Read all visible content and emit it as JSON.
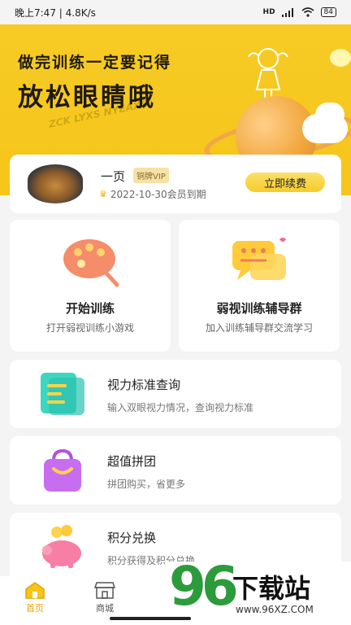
{
  "status_bar": {
    "time_speed": "晚上7:47 | 4.8K/s",
    "signal1": "HD",
    "battery": "84"
  },
  "hero": {
    "line1": "做完训练一定要记得",
    "line2": "放松眼睛哦",
    "chart_letters": "ZCK LYXS NYEAXS"
  },
  "member": {
    "name": "一页",
    "badge": "铜牌VIP",
    "expire": "2022-10-30会员到期",
    "renew_label": "立即续费"
  },
  "features": [
    {
      "title": "开始训练",
      "subtitle": "打开弱视训练小游戏"
    },
    {
      "title": "弱视训练辅导群",
      "subtitle": "加入训练辅导群交流学习"
    }
  ],
  "rows": [
    {
      "title": "视力标准查询",
      "subtitle": "输入双眼视力情况，查询视力标准"
    },
    {
      "title": "超值拼团",
      "subtitle": "拼团购买，省更多"
    },
    {
      "title": "积分兑换",
      "subtitle": "积分获得及积分兑换"
    }
  ],
  "tabs": [
    {
      "label": "首页",
      "active": true
    },
    {
      "label": "商城",
      "active": false
    }
  ],
  "watermark": {
    "number": "96",
    "text": "下载站",
    "url": "www.96XZ.COM"
  },
  "colors": {
    "brand_yellow": "#f7cb25",
    "active_tab": "#e8a300",
    "watermark_green": "#2c9b3c"
  }
}
